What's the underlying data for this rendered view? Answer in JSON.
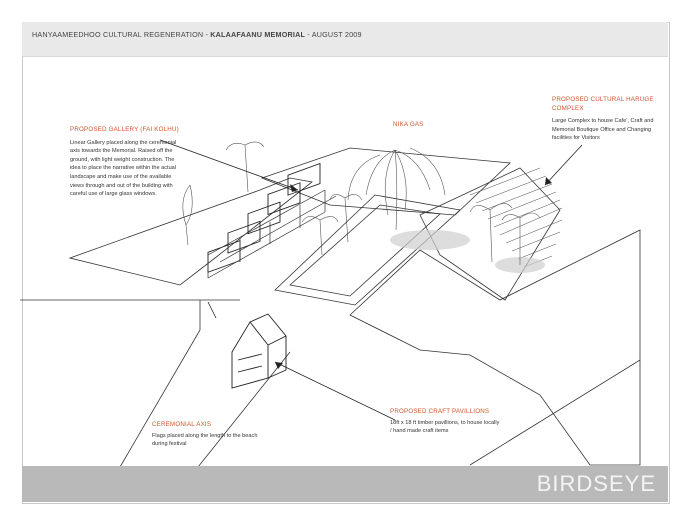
{
  "header": {
    "prefix": "HANYAAMEEDHOO CULTURAL REGENERATION - ",
    "project": "KALAAFAANU MEMORIAL",
    "suffix": " - AUGUST 2009"
  },
  "footer": {
    "view_label": "BIRDSEYE"
  },
  "annotations": {
    "gallery": {
      "title": "PROPOSED GALLERY (FAI KOLHU)",
      "body": "Linear Gallery placed along the ceremonial axis towards the Memorial. Raised off the ground, with light weight construction. The idea to place the narrative within the actual landscape and make use of the available views through and out of the building with careful use of large glass windows."
    },
    "nika": {
      "title": "NIKA GAS"
    },
    "harube": {
      "title": "PROPOSED CULTURAL HARUGE COMPLEX",
      "body": "Large Complex to house Cafe', Craft and Memorial Boutique Office and Changing facilities for Visitors"
    },
    "pavilions": {
      "title": "PROPOSED CRAFT PAVILLIONS",
      "body": "18ft x 18 ft timber pavillions, to house locally / hand made craft items"
    },
    "axis": {
      "title": "CEREMONIAL AXIS",
      "body": "Flags placed along the length to the beach during festival"
    }
  },
  "colors": {
    "accent": "#d2542c",
    "line": "#333333",
    "header_bg": "#e9e9e9",
    "footer_bg": "#b9b9b9"
  }
}
